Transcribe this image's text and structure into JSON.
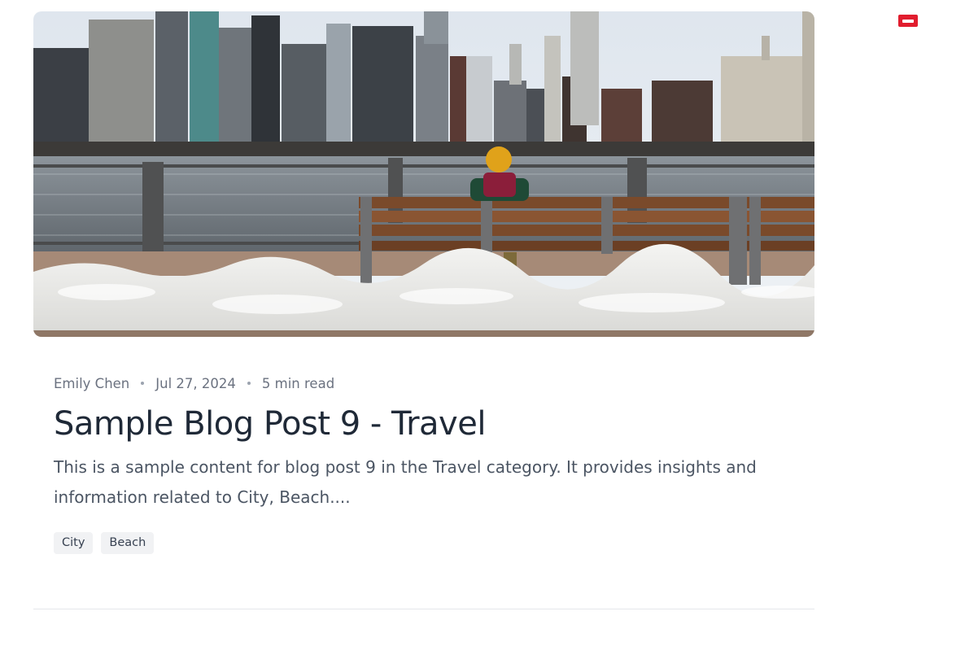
{
  "post": {
    "author": "Emily Chen",
    "date": "Jul 27, 2024",
    "read_time": "5 min read",
    "title": "Sample Blog Post 9 - Travel",
    "excerpt": "This is a sample content for blog post 9 in the Travel category. It provides insights and information related to City, Beach....",
    "tags": [
      "City",
      "Beach"
    ]
  },
  "colors": {
    "accent": "#e11d2e",
    "title": "#1f2937",
    "meta": "#6b7280",
    "tag_bg": "#f1f2f4"
  },
  "icons": {
    "corner_badge": "minus-badge-icon"
  }
}
